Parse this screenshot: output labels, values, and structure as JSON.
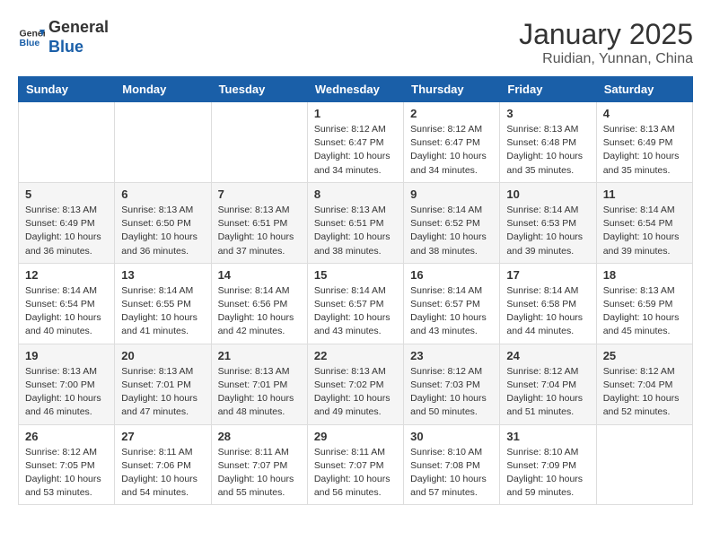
{
  "header": {
    "logo_line1": "General",
    "logo_line2": "Blue",
    "month": "January 2025",
    "location": "Ruidian, Yunnan, China"
  },
  "days_of_week": [
    "Sunday",
    "Monday",
    "Tuesday",
    "Wednesday",
    "Thursday",
    "Friday",
    "Saturday"
  ],
  "weeks": [
    [
      {
        "day": "",
        "info": ""
      },
      {
        "day": "",
        "info": ""
      },
      {
        "day": "",
        "info": ""
      },
      {
        "day": "1",
        "info": "Sunrise: 8:12 AM\nSunset: 6:47 PM\nDaylight: 10 hours\nand 34 minutes."
      },
      {
        "day": "2",
        "info": "Sunrise: 8:12 AM\nSunset: 6:47 PM\nDaylight: 10 hours\nand 34 minutes."
      },
      {
        "day": "3",
        "info": "Sunrise: 8:13 AM\nSunset: 6:48 PM\nDaylight: 10 hours\nand 35 minutes."
      },
      {
        "day": "4",
        "info": "Sunrise: 8:13 AM\nSunset: 6:49 PM\nDaylight: 10 hours\nand 35 minutes."
      }
    ],
    [
      {
        "day": "5",
        "info": "Sunrise: 8:13 AM\nSunset: 6:49 PM\nDaylight: 10 hours\nand 36 minutes."
      },
      {
        "day": "6",
        "info": "Sunrise: 8:13 AM\nSunset: 6:50 PM\nDaylight: 10 hours\nand 36 minutes."
      },
      {
        "day": "7",
        "info": "Sunrise: 8:13 AM\nSunset: 6:51 PM\nDaylight: 10 hours\nand 37 minutes."
      },
      {
        "day": "8",
        "info": "Sunrise: 8:13 AM\nSunset: 6:51 PM\nDaylight: 10 hours\nand 38 minutes."
      },
      {
        "day": "9",
        "info": "Sunrise: 8:14 AM\nSunset: 6:52 PM\nDaylight: 10 hours\nand 38 minutes."
      },
      {
        "day": "10",
        "info": "Sunrise: 8:14 AM\nSunset: 6:53 PM\nDaylight: 10 hours\nand 39 minutes."
      },
      {
        "day": "11",
        "info": "Sunrise: 8:14 AM\nSunset: 6:54 PM\nDaylight: 10 hours\nand 39 minutes."
      }
    ],
    [
      {
        "day": "12",
        "info": "Sunrise: 8:14 AM\nSunset: 6:54 PM\nDaylight: 10 hours\nand 40 minutes."
      },
      {
        "day": "13",
        "info": "Sunrise: 8:14 AM\nSunset: 6:55 PM\nDaylight: 10 hours\nand 41 minutes."
      },
      {
        "day": "14",
        "info": "Sunrise: 8:14 AM\nSunset: 6:56 PM\nDaylight: 10 hours\nand 42 minutes."
      },
      {
        "day": "15",
        "info": "Sunrise: 8:14 AM\nSunset: 6:57 PM\nDaylight: 10 hours\nand 43 minutes."
      },
      {
        "day": "16",
        "info": "Sunrise: 8:14 AM\nSunset: 6:57 PM\nDaylight: 10 hours\nand 43 minutes."
      },
      {
        "day": "17",
        "info": "Sunrise: 8:14 AM\nSunset: 6:58 PM\nDaylight: 10 hours\nand 44 minutes."
      },
      {
        "day": "18",
        "info": "Sunrise: 8:13 AM\nSunset: 6:59 PM\nDaylight: 10 hours\nand 45 minutes."
      }
    ],
    [
      {
        "day": "19",
        "info": "Sunrise: 8:13 AM\nSunset: 7:00 PM\nDaylight: 10 hours\nand 46 minutes."
      },
      {
        "day": "20",
        "info": "Sunrise: 8:13 AM\nSunset: 7:01 PM\nDaylight: 10 hours\nand 47 minutes."
      },
      {
        "day": "21",
        "info": "Sunrise: 8:13 AM\nSunset: 7:01 PM\nDaylight: 10 hours\nand 48 minutes."
      },
      {
        "day": "22",
        "info": "Sunrise: 8:13 AM\nSunset: 7:02 PM\nDaylight: 10 hours\nand 49 minutes."
      },
      {
        "day": "23",
        "info": "Sunrise: 8:12 AM\nSunset: 7:03 PM\nDaylight: 10 hours\nand 50 minutes."
      },
      {
        "day": "24",
        "info": "Sunrise: 8:12 AM\nSunset: 7:04 PM\nDaylight: 10 hours\nand 51 minutes."
      },
      {
        "day": "25",
        "info": "Sunrise: 8:12 AM\nSunset: 7:04 PM\nDaylight: 10 hours\nand 52 minutes."
      }
    ],
    [
      {
        "day": "26",
        "info": "Sunrise: 8:12 AM\nSunset: 7:05 PM\nDaylight: 10 hours\nand 53 minutes."
      },
      {
        "day": "27",
        "info": "Sunrise: 8:11 AM\nSunset: 7:06 PM\nDaylight: 10 hours\nand 54 minutes."
      },
      {
        "day": "28",
        "info": "Sunrise: 8:11 AM\nSunset: 7:07 PM\nDaylight: 10 hours\nand 55 minutes."
      },
      {
        "day": "29",
        "info": "Sunrise: 8:11 AM\nSunset: 7:07 PM\nDaylight: 10 hours\nand 56 minutes."
      },
      {
        "day": "30",
        "info": "Sunrise: 8:10 AM\nSunset: 7:08 PM\nDaylight: 10 hours\nand 57 minutes."
      },
      {
        "day": "31",
        "info": "Sunrise: 8:10 AM\nSunset: 7:09 PM\nDaylight: 10 hours\nand 59 minutes."
      },
      {
        "day": "",
        "info": ""
      }
    ]
  ]
}
